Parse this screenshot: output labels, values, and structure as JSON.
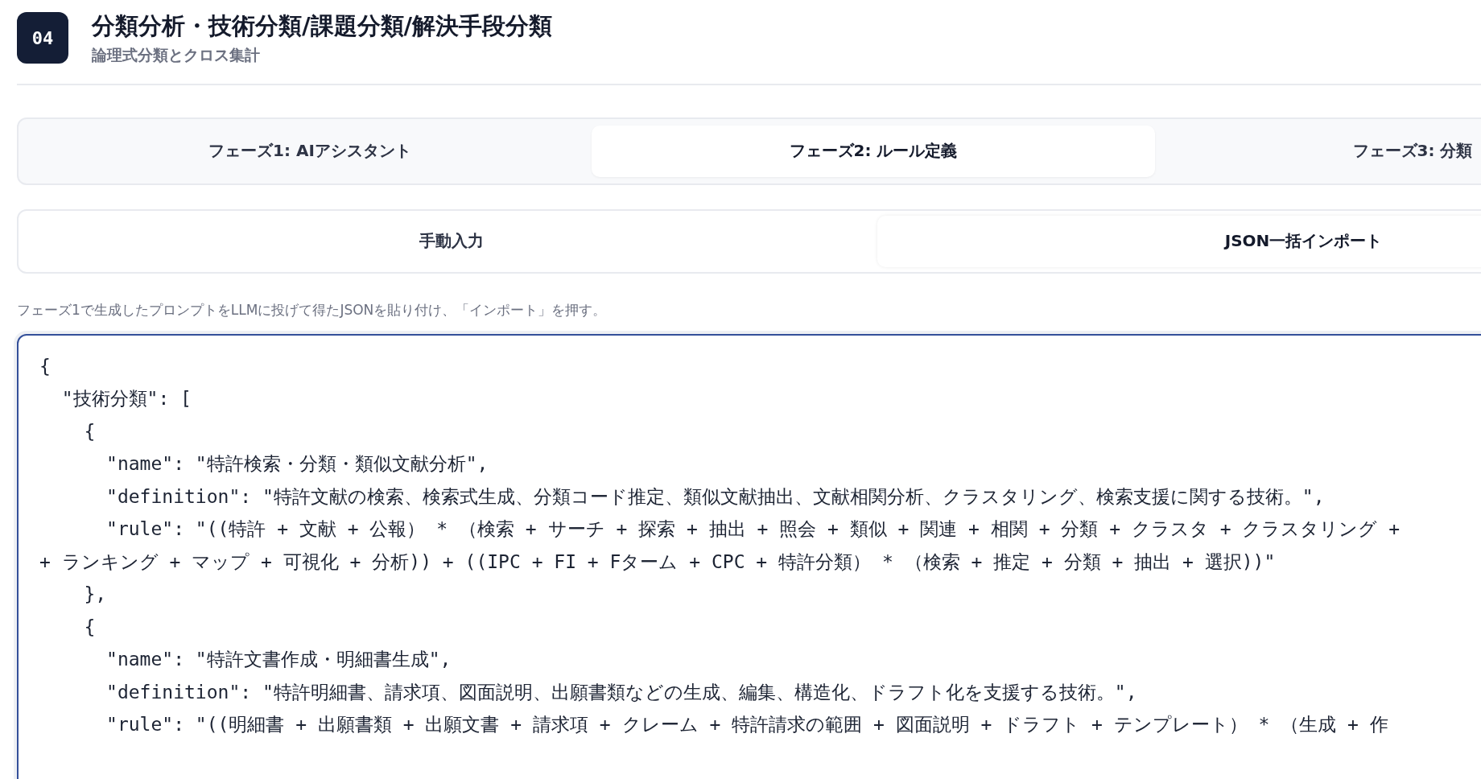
{
  "header": {
    "badge": "04",
    "title": "分類分析・技術分類/課題分類/解決手段分類",
    "subtitle": "論理式分類とクロス集計"
  },
  "phase_tabs": [
    {
      "label": "フェーズ1: AIアシスタント",
      "selected": false
    },
    {
      "label": "フェーズ2: ルール定義",
      "selected": true
    },
    {
      "label": "フェーズ3: 分類",
      "selected": false
    }
  ],
  "input_tabs": [
    {
      "label": "手動入力",
      "selected": false
    },
    {
      "label": "JSON一括インポート",
      "selected": true
    }
  ],
  "hint": "フェーズ1で生成したプロンプトをLLMに投げて得たJSONを貼り付け、「インポート」を押す。",
  "json_input": {
    "focused": true,
    "lines": [
      "{",
      "  \"技術分類\": [",
      "    {",
      "      \"name\": \"特許検索・分類・類似文献分析\",",
      "      \"definition\": \"特許文献の検索、検索式生成、分類コード推定、類似文献抽出、文献相関分析、クラスタリング、検索支援に関する技術。\",",
      "      \"rule\": \"((特許 + 文献 + 公報） * （検索 + サーチ + 探索 + 抽出 + 照会 + 類似 + 関連 + 相関 + 分類 + クラスタ + クラスタリング +",
      "+ ランキング + マップ + 可視化 + 分析)) + ((IPC + FI + Fターム + CPC + 特許分類） * （検索 + 推定 + 分類 + 抽出 + 選択))\"",
      "    },",
      "    {",
      "      \"name\": \"特許文書作成・明細書生成\",",
      "      \"definition\": \"特許明細書、請求項、図面説明、出願書類などの生成、編集、構造化、ドラフト化を支援する技術。\",",
      "      \"rule\": \"((明細書 + 出願書類 + 出願文書 + 請求項 + クレーム + 特許請求の範囲 + 図面説明 + ドラフト + テンプレート） * （生成 + 作"
    ]
  }
}
